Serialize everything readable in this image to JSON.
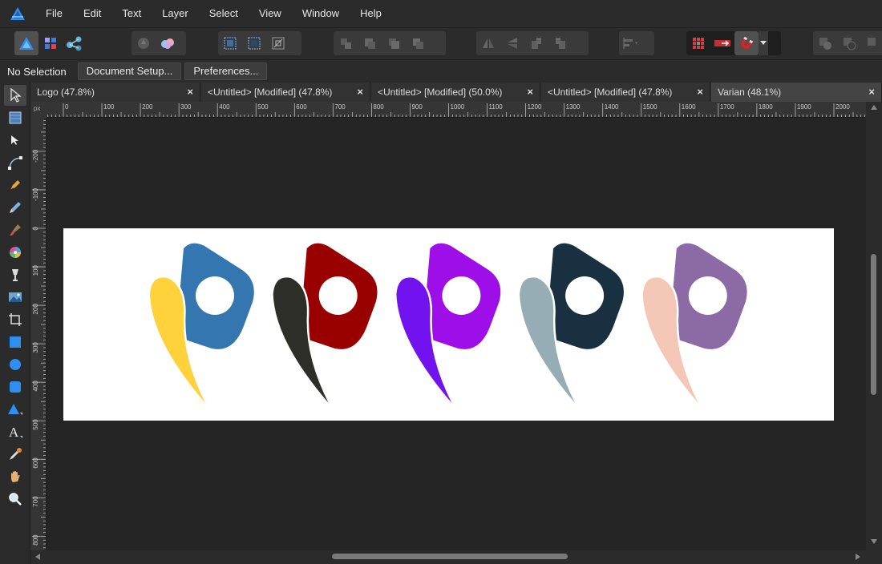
{
  "app": {
    "logo_icon": "affinity-designer-triangle-icon",
    "accent": "#2f8ff0"
  },
  "menu": [
    "File",
    "Edit",
    "Text",
    "Layer",
    "Select",
    "View",
    "Window",
    "Help"
  ],
  "toolbar": {
    "personas": [
      "designer-persona-icon",
      "pixel-persona-icon",
      "export-persona-icon"
    ],
    "groups": [
      [
        "insert-front-icon",
        "snapping-settings-icon"
      ],
      [
        "select-all-icon",
        "select-none-icon",
        "transform-icon"
      ],
      [
        "order-back-icon",
        "order-backward-icon",
        "order-forward-icon",
        "order-front-icon"
      ],
      [
        "flip-horizontal-icon",
        "flip-vertical-icon",
        "rotate-left-icon",
        "rotate-right-icon"
      ],
      [
        "align-icon"
      ],
      [
        "grid-icon",
        "boolean-icon",
        "snap-magnet-icon"
      ],
      [
        "add-icon",
        "subtract-icon",
        "intersect-icon"
      ]
    ]
  },
  "context": {
    "status": "No Selection",
    "document_setup": "Document Setup...",
    "preferences": "Preferences..."
  },
  "tabs": [
    {
      "label": "Logo (47.8%)",
      "close": "×"
    },
    {
      "label": "<Untitled> [Modified] (47.8%)",
      "close": "×"
    },
    {
      "label": "<Untitled> [Modified] (50.0%)",
      "close": "×"
    },
    {
      "label": "<Untitled> [Modified] (47.8%)",
      "close": "×"
    },
    {
      "label": "Varian (48.1%)",
      "close": "×"
    }
  ],
  "ruler": {
    "unit": "px",
    "h_labels": [
      "0",
      "100",
      "200",
      "300",
      "400",
      "500",
      "600",
      "700",
      "800",
      "900",
      "1000",
      "1100",
      "1200",
      "1300",
      "1400",
      "1500",
      "1600",
      "1700",
      "1800",
      "1900",
      "2000"
    ],
    "v_labels": [
      "-200",
      "-100",
      "0",
      "100",
      "200",
      "300",
      "400",
      "500",
      "600",
      "700",
      "800"
    ]
  },
  "logos": [
    {
      "head": "#3476b0",
      "tail": "#ffd13b"
    },
    {
      "head": "#990000",
      "tail": "#2e2e29"
    },
    {
      "head": "#9e0ee9",
      "tail": "#7213ef"
    },
    {
      "head": "#183040",
      "tail": "#96adb5"
    },
    {
      "head": "#8b6aa5",
      "tail": "#f3c6b6"
    }
  ],
  "tools": [
    "move-tool-icon",
    "artboard-tool-icon",
    "node-tool-icon",
    "corner-tool-icon",
    "pen-tool-icon",
    "pencil-tool-icon",
    "brush-tool-icon",
    "fill-tool-icon",
    "transparency-tool-icon",
    "place-image-tool-icon",
    "crop-tool-icon",
    "rectangle-tool-icon",
    "ellipse-tool-icon",
    "rounded-rectangle-tool-icon",
    "triangle-tool-icon",
    "text-tool-icon",
    "color-picker-tool-icon",
    "hand-tool-icon",
    "zoom-tool-icon"
  ]
}
